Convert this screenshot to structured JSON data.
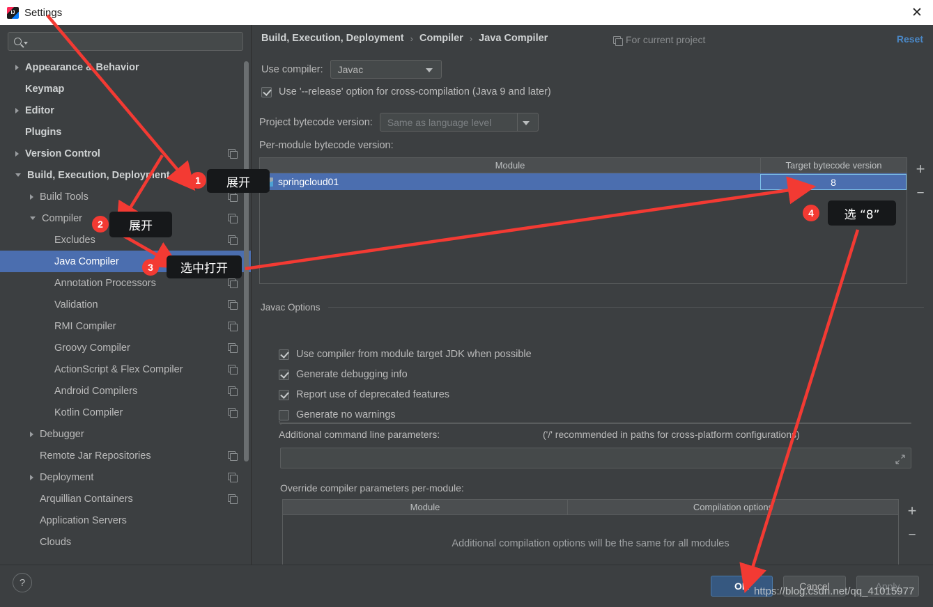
{
  "window": {
    "title": "Settings",
    "logo_icon": "intellij-idea-logo",
    "close_icon": "close-icon"
  },
  "sidebar": {
    "search": {
      "placeholder": "",
      "value": "",
      "icon": "search-icon",
      "dropdown_icon": "chevron-down-icon"
    },
    "items": [
      {
        "label": "Appearance & Behavior",
        "indent": 0,
        "arrow": "collapsed",
        "bold": true,
        "copy": false,
        "selected": false
      },
      {
        "label": "Keymap",
        "indent": 0,
        "arrow": "none",
        "bold": true,
        "copy": false,
        "selected": false
      },
      {
        "label": "Editor",
        "indent": 0,
        "arrow": "collapsed",
        "bold": true,
        "copy": false,
        "selected": false
      },
      {
        "label": "Plugins",
        "indent": 0,
        "arrow": "none",
        "bold": true,
        "copy": false,
        "selected": false
      },
      {
        "label": "Version Control",
        "indent": 0,
        "arrow": "collapsed",
        "bold": true,
        "copy": true,
        "selected": false
      },
      {
        "label": "Build, Execution, Deployment",
        "indent": 0,
        "arrow": "expanded",
        "bold": true,
        "copy": false,
        "selected": false
      },
      {
        "label": "Build Tools",
        "indent": 1,
        "arrow": "collapsed",
        "bold": false,
        "copy": true,
        "selected": false
      },
      {
        "label": "Compiler",
        "indent": 1,
        "arrow": "expanded",
        "bold": false,
        "copy": true,
        "selected": false
      },
      {
        "label": "Excludes",
        "indent": 2,
        "arrow": "none",
        "bold": false,
        "copy": true,
        "selected": false
      },
      {
        "label": "Java Compiler",
        "indent": 2,
        "arrow": "none",
        "bold": false,
        "copy": true,
        "selected": true
      },
      {
        "label": "Annotation Processors",
        "indent": 2,
        "arrow": "none",
        "bold": false,
        "copy": true,
        "selected": false
      },
      {
        "label": "Validation",
        "indent": 2,
        "arrow": "none",
        "bold": false,
        "copy": true,
        "selected": false
      },
      {
        "label": "RMI Compiler",
        "indent": 2,
        "arrow": "none",
        "bold": false,
        "copy": true,
        "selected": false
      },
      {
        "label": "Groovy Compiler",
        "indent": 2,
        "arrow": "none",
        "bold": false,
        "copy": true,
        "selected": false
      },
      {
        "label": "ActionScript & Flex Compiler",
        "indent": 2,
        "arrow": "none",
        "bold": false,
        "copy": true,
        "selected": false
      },
      {
        "label": "Android Compilers",
        "indent": 2,
        "arrow": "none",
        "bold": false,
        "copy": true,
        "selected": false
      },
      {
        "label": "Kotlin Compiler",
        "indent": 2,
        "arrow": "none",
        "bold": false,
        "copy": true,
        "selected": false
      },
      {
        "label": "Debugger",
        "indent": 1,
        "arrow": "collapsed",
        "bold": false,
        "copy": false,
        "selected": false
      },
      {
        "label": "Remote Jar Repositories",
        "indent": 1,
        "arrow": "none",
        "bold": false,
        "copy": true,
        "selected": false
      },
      {
        "label": "Deployment",
        "indent": 1,
        "arrow": "collapsed",
        "bold": false,
        "copy": true,
        "selected": false
      },
      {
        "label": "Arquillian Containers",
        "indent": 1,
        "arrow": "none",
        "bold": false,
        "copy": true,
        "selected": false
      },
      {
        "label": "Application Servers",
        "indent": 1,
        "arrow": "none",
        "bold": false,
        "copy": false,
        "selected": false
      },
      {
        "label": "Clouds",
        "indent": 1,
        "arrow": "none",
        "bold": false,
        "copy": false,
        "selected": false
      }
    ]
  },
  "main": {
    "breadcrumb": [
      "Build, Execution, Deployment",
      "Compiler",
      "Java Compiler"
    ],
    "breadcrumb_separator": "›",
    "scope_label": "For current project",
    "scope_icon": "copy-icon",
    "reset_label": "Reset",
    "reset_color": "#4a88c7",
    "use_compiler_label": "Use compiler:",
    "use_compiler_value": "Javac",
    "release_option": {
      "label": "Use '--release' option for cross-compilation (Java 9 and later)",
      "checked": true
    },
    "project_bytecode_label": "Project bytecode version:",
    "project_bytecode_value": "Same as language level",
    "per_module_label": "Per-module bytecode version:",
    "module_table": {
      "columns": [
        "Module",
        "Target bytecode version"
      ],
      "rows": [
        {
          "module": "springcloud01",
          "version": "8",
          "selected": true,
          "icon": "module-icon"
        }
      ],
      "add_label": "+",
      "remove_label": "−"
    },
    "javac_options": {
      "title": "Javac Options",
      "checkboxes": [
        {
          "label": "Use compiler from module target JDK when possible",
          "checked": true
        },
        {
          "label": "Generate debugging info",
          "checked": true
        },
        {
          "label": "Report use of deprecated features",
          "checked": true
        },
        {
          "label": "Generate no warnings",
          "checked": false
        }
      ],
      "additional_params_label": "Additional command line parameters:",
      "additional_params_hint": "('/' recommended in paths for cross-platform configurations)",
      "additional_params_value": "",
      "expand_icon": "expand-icon"
    },
    "override_section": {
      "label": "Override compiler parameters per-module:",
      "columns": [
        "Module",
        "Compilation options"
      ],
      "empty_message": "Additional compilation options will be the same for all modules",
      "add_label": "+",
      "remove_label": "−"
    }
  },
  "footer": {
    "help_label": "?",
    "ok_label": "OK",
    "cancel_label": "Cancel",
    "apply_label": "Apply",
    "ok_color": "#365880",
    "watermark": "https://blog.csdn.net/qq_41015977"
  },
  "annotations": {
    "accent_color": "#f33a33",
    "callouts": [
      {
        "number": "1",
        "text": "展开"
      },
      {
        "number": "2",
        "text": "展开"
      },
      {
        "number": "3",
        "text": "选中打开"
      },
      {
        "number": "4",
        "text": "选 “8”"
      }
    ]
  }
}
